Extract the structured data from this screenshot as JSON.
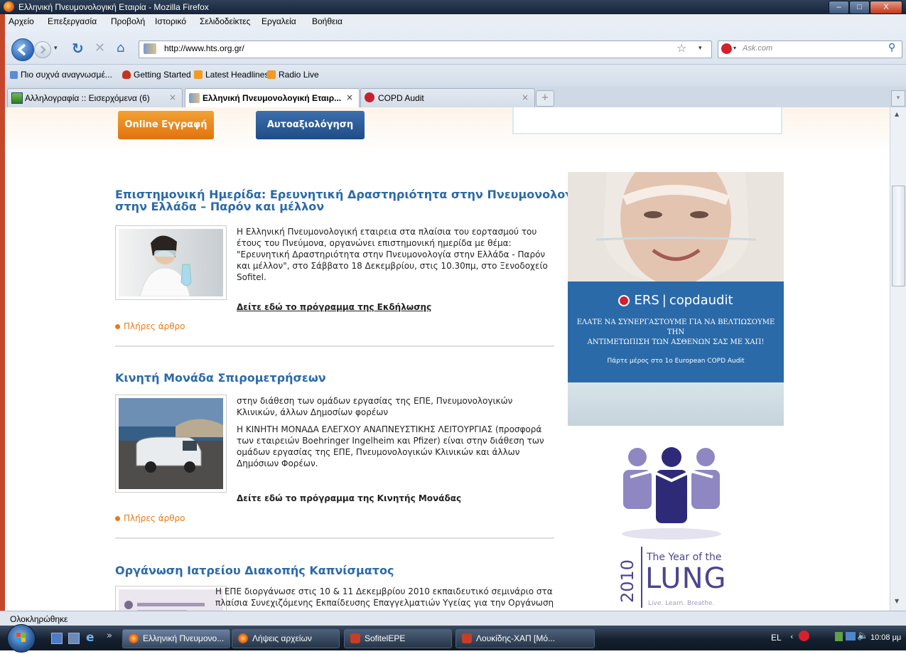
{
  "window": {
    "title": "Ελληνική Πνευμονολογική Εταιρία - Mozilla Firefox",
    "min": "–",
    "max": "□",
    "close": "X"
  },
  "menu": [
    "Αρχείο",
    "Επεξεργασία",
    "Προβολή",
    "Ιστορικό",
    "Σελιδοδείκτες",
    "Εργαλεία",
    "Βοήθεια"
  ],
  "nav": {
    "url": "http://www.hts.org.gr/",
    "search_placeholder": "Ask.com"
  },
  "bookmarks": [
    "Πιο συχνά αναγνωσμέ...",
    "Getting Started",
    "Latest Headlines",
    "Radio Live"
  ],
  "tabs": [
    {
      "label": "Αλληλογραφία :: Εισερχόμενα (6)",
      "active": false
    },
    {
      "label": "Ελληνική Πνευμονολογική Εταιρ...",
      "active": true
    },
    {
      "label": "COPD Audit",
      "active": false
    }
  ],
  "page": {
    "btn_online": "Online Εγγραφή",
    "btn_self": "Αυτοαξιολόγηση",
    "articles": [
      {
        "title_1": "Επιστημονική Ημερίδα: Ερευνητική Δραστηριότητα στην Πνευμονολογία",
        "title_2": "στην Ελλάδα – Παρόν και μέλλον",
        "body": [
          "Η Ελληνική Πνευμονολογική εταιρεια στα πλαίσια του εορτασμού του",
          "έτους του Πνεύμονα, οργανώνει επιστημονική ημερίδα με θέμα:",
          "\"Ερευνητική Δραστηριότητα στην Πνευμονολογία στην Ελλάδα - Παρόν",
          "και μέλλον\", στο Σάββατο 18 Δεκεμβρίου, στις 10.30πμ, στο Ξενοδοχείο",
          "Sofitel."
        ],
        "link": "Δείτε εδώ το πρόγραμμα της Εκδήλωσης",
        "more": "Πλήρες άρθρο"
      },
      {
        "title_1": "Κινητή Μονάδα Σπιρομετρήσεων",
        "body": [
          " στην διάθεση των ομάδων εργασίας της ΕΠΕ, Πνευμονολογικών",
          "Κλινικών, άλλων Δημοσίων φορέων",
          "",
          "Η ΚΙΝΗΤΗ ΜΟΝΑΔΑ ΕΛΕΓΧΟΥ ΑΝΑΠΝΕΥΣΤΙΚΗΣ ΛΕΙΤΟΥΡΓΙΑΣ (προσφορά",
          "των εταιρειών Boehringer Ingelheim και Pfizer) είναι στην διάθεση των",
          "ομάδων εργασίας της ΕΠΕ, Πνευμονολογικών Κλινικών και άλλων",
          "Δημόσιων Φορέων."
        ],
        "link": "Δείτε εδώ το πρόγραμμα της Κινητής Μονάδας",
        "more": "Πλήρες άρθρο"
      },
      {
        "title_1": "Οργάνωση Ιατρείου Διακοπής Καπνίσματος",
        "body": [
          "Η ΕΠΕ διοργάνωσε στις 10 & 11 Δεκεμβρίου 2010 εκπαιδευτικό σεμινάριο στα",
          "πλαίσια Συνεχιζόμενης Εκπαίδευσης Επαγγελματιών Υγείας για την Οργάνωση"
        ]
      }
    ],
    "ad_ers": {
      "brand_ers": "ERS",
      "brand_rest": "copdaudit",
      "text_1": "ΕΛΑΤΕ ΝΑ ΣΥΝΕΡΓΑΣΤΟΥΜΕ ΓΙΑ ΝΑ ΒΕΛΤΙΩΣΟΥΜΕ ΤΗΝ",
      "text_2": "ΑΝΤΙΜΕΤΩΠΙΣΗ ΤΩΝ ΑΣΘΕΝΩΝ ΣΑΣ ΜΕ ΧΑΠ!",
      "cta": "Πάρτε μέρος στο 1ο European COPD Audit"
    },
    "ad_lung": {
      "year": "2010",
      "line1": "The Year of the",
      "line2": "LUNG",
      "line3": "Live. Learn. Breathe."
    }
  },
  "status": "Ολοκληρώθηκε",
  "taskbar": {
    "items": [
      "Ελληνική Πνευμονο...",
      "Λήψεις αρχείων",
      "SofitelEPE",
      "Λουκίδης-ΧΑΠ [Μό..."
    ],
    "lang": "EL",
    "time": "10:08 μμ"
  },
  "colors": {
    "link_blue": "#2b6aa8",
    "orange": "#e87a19",
    "ers_blue": "#2b6aa8",
    "lung_purple": "#7a6bb0"
  }
}
